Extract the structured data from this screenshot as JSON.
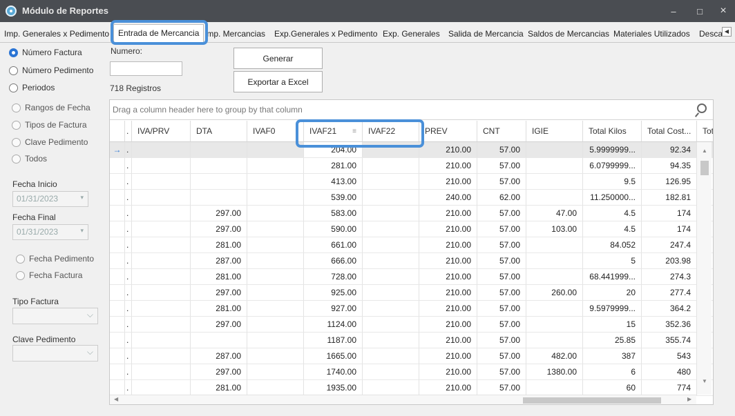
{
  "window": {
    "title": "Módulo de Reportes",
    "minimize": "–",
    "maximize": "□",
    "close": "×"
  },
  "tabs": [
    "Imp. Generales x Pedimento",
    "Entrada de Mercancia",
    "Imp. Mercancias",
    "Exp.Generales x Pedimento",
    "Exp. Generales",
    "Salida de Mercancia",
    "Saldos de Mercancias",
    "Materiales Utilizados",
    "Desca"
  ],
  "active_tab": "Entrada de Mercancia",
  "search_options": [
    "Número Factura",
    "Número Pedimento",
    "Periodos"
  ],
  "range_options": [
    "Rangos de Fecha",
    "Tipos de Factura",
    "Clave Pedimento",
    "Todos"
  ],
  "fecha_inicio": {
    "label": "Fecha Inicio",
    "value": "01/31/2023"
  },
  "fecha_final": {
    "label": "Fecha Final",
    "value": "01/31/2023"
  },
  "fecha_options": [
    "Fecha Pedimento",
    "Fecha Factura"
  ],
  "tipo_factura": {
    "label": "Tipo Factura"
  },
  "clave_pedimento": {
    "label": "Clave Pedimento"
  },
  "numero": {
    "label": "Numero:",
    "value": ""
  },
  "registros": "718 Registros",
  "buttons": {
    "generar": "Generar",
    "exportar": "Exportar a Excel"
  },
  "grid": {
    "group_prompt": "Drag a column header here to group by that column",
    "columns": [
      "IVA/PRV",
      "DTA",
      "IVAF0",
      "IVAF21",
      "IVAF22",
      "PREV",
      "CNT",
      "IGIE",
      "Total Kilos",
      "Total Cost...",
      "Tota"
    ],
    "rows": [
      [
        "",
        "",
        "",
        "204.00",
        "",
        "210.00",
        "57.00",
        "",
        "5.9999999...",
        "92.34"
      ],
      [
        "",
        "",
        "",
        "281.00",
        "",
        "210.00",
        "57.00",
        "",
        "6.0799999...",
        "94.35"
      ],
      [
        "",
        "",
        "",
        "413.00",
        "",
        "210.00",
        "57.00",
        "",
        "9.5",
        "126.95"
      ],
      [
        "",
        "",
        "",
        "539.00",
        "",
        "240.00",
        "62.00",
        "",
        "11.250000...",
        "182.81"
      ],
      [
        "",
        "297.00",
        "",
        "583.00",
        "",
        "210.00",
        "57.00",
        "47.00",
        "4.5",
        "174"
      ],
      [
        "",
        "297.00",
        "",
        "590.00",
        "",
        "210.00",
        "57.00",
        "103.00",
        "4.5",
        "174"
      ],
      [
        "",
        "281.00",
        "",
        "661.00",
        "",
        "210.00",
        "57.00",
        "",
        "84.052",
        "247.4"
      ],
      [
        "",
        "287.00",
        "",
        "666.00",
        "",
        "210.00",
        "57.00",
        "",
        "5",
        "203.98"
      ],
      [
        "",
        "281.00",
        "",
        "728.00",
        "",
        "210.00",
        "57.00",
        "",
        "68.441999...",
        "274.3"
      ],
      [
        "",
        "297.00",
        "",
        "925.00",
        "",
        "210.00",
        "57.00",
        "260.00",
        "20",
        "277.4"
      ],
      [
        "",
        "281.00",
        "",
        "927.00",
        "",
        "210.00",
        "57.00",
        "",
        "9.5979999...",
        "364.2"
      ],
      [
        "",
        "297.00",
        "",
        "1124.00",
        "",
        "210.00",
        "57.00",
        "",
        "15",
        "352.36"
      ],
      [
        "",
        "",
        "",
        "1187.00",
        "",
        "210.00",
        "57.00",
        "",
        "25.85",
        "355.74"
      ],
      [
        "",
        "287.00",
        "",
        "1665.00",
        "",
        "210.00",
        "57.00",
        "482.00",
        "387",
        "543"
      ],
      [
        "",
        "297.00",
        "",
        "1740.00",
        "",
        "210.00",
        "57.00",
        "1380.00",
        "6",
        "480"
      ],
      [
        "",
        "281.00",
        "",
        "1935.00",
        "",
        "210.00",
        "57.00",
        "",
        "60",
        "774"
      ]
    ]
  }
}
